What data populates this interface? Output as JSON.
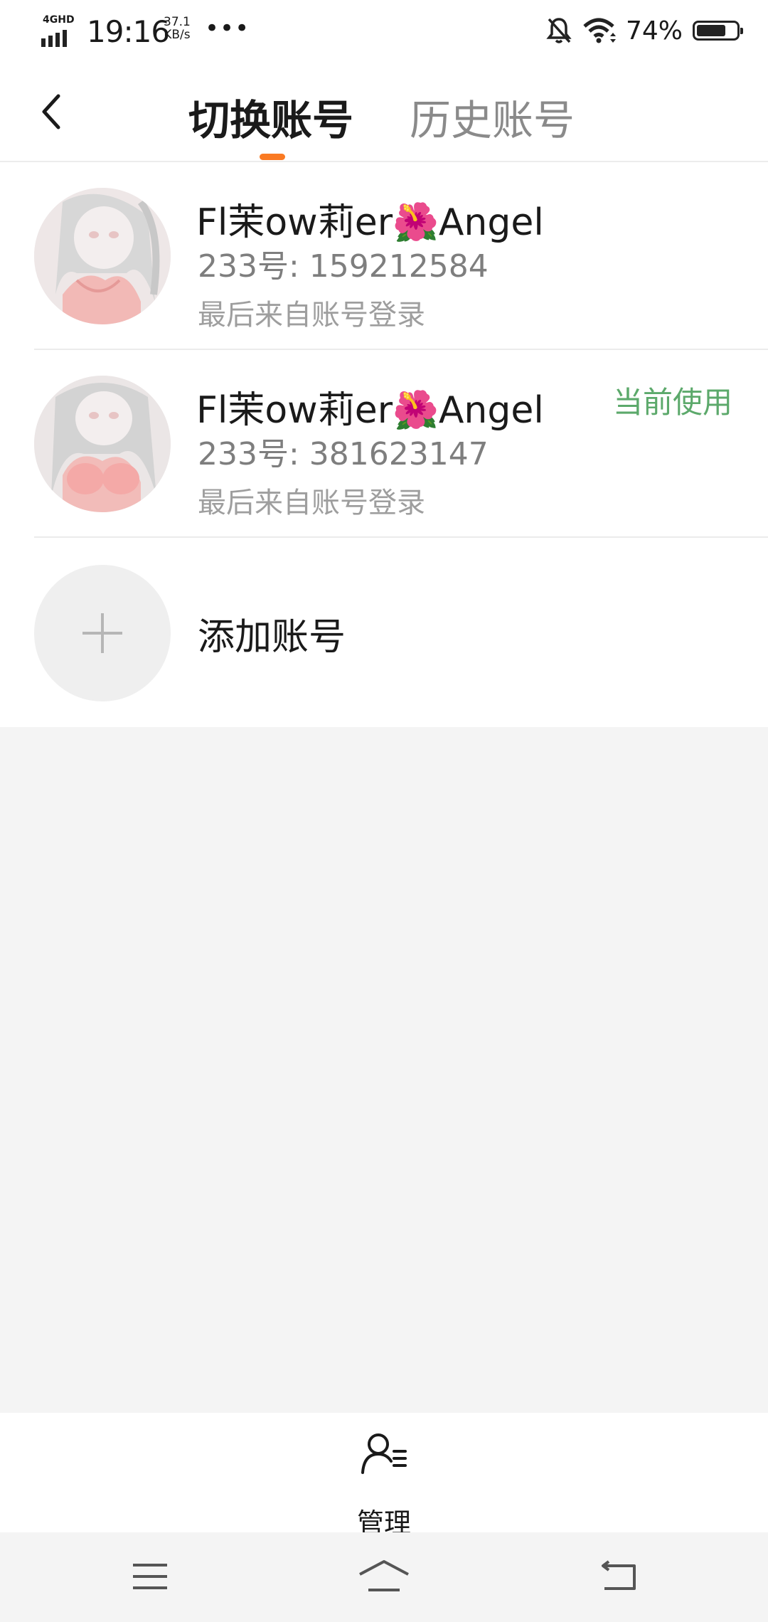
{
  "status_bar": {
    "network": "4GHD",
    "time": "19:16",
    "speed_value": "37.1",
    "speed_unit": "KB/s",
    "more": "•••",
    "battery_percent": "74%",
    "battery_level": 0.74,
    "icons": [
      "signal-icon",
      "mute-bell-icon",
      "wifi-icon",
      "battery-icon"
    ]
  },
  "header": {
    "back_icon": "chevron-left-icon",
    "tabs": [
      {
        "label": "切换账号",
        "active": true
      },
      {
        "label": "历史账号",
        "active": false
      }
    ],
    "accent_color": "#fa7a23"
  },
  "accounts": [
    {
      "name": "Fl茉ow莉er🌺Angel",
      "id_line": "233号: 159212584",
      "login_source": "最后来自账号登录",
      "current": false
    },
    {
      "name": "Fl茉ow莉er🌺Angel",
      "id_line": "233号: 381623147",
      "login_source": "最后来自账号登录",
      "current": true,
      "current_label": "当前使用"
    }
  ],
  "add_account": {
    "label": "添加账号",
    "icon": "plus-icon"
  },
  "bottom_bar": {
    "manage_label": "管理",
    "icon": "user-manage-icon"
  },
  "nav_bar": {
    "icons": [
      "menu-icon",
      "home-icon",
      "back-nav-icon"
    ]
  },
  "colors": {
    "current_green": "#5ca96b",
    "background": "#f4f4f4"
  }
}
